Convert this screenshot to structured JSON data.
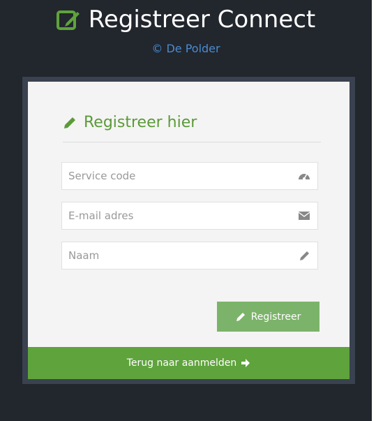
{
  "header": {
    "title": "Registreer Connect",
    "title_icon": "edit-square-icon",
    "copyright": "© De Polder"
  },
  "form": {
    "heading": "Registreer hier",
    "heading_icon": "pencil-icon",
    "fields": [
      {
        "placeholder": "Service code",
        "value": "",
        "icon": "dashboard-icon"
      },
      {
        "placeholder": "E-mail adres",
        "value": "",
        "icon": "envelope-icon"
      },
      {
        "placeholder": "Naam",
        "value": "",
        "icon": "pencil-icon"
      }
    ],
    "submit_label": "Registreer",
    "submit_icon": "pencil-icon"
  },
  "footer": {
    "back_label": "Terug naar aanmelden",
    "back_icon": "arrow-right-icon"
  },
  "colors": {
    "background": "#22262d",
    "card": "#f4f4f4",
    "accent_green": "#5fa33c",
    "button_green": "#7cb36a",
    "heading_green": "#5b9a38",
    "link_blue": "#4a8bd1"
  }
}
